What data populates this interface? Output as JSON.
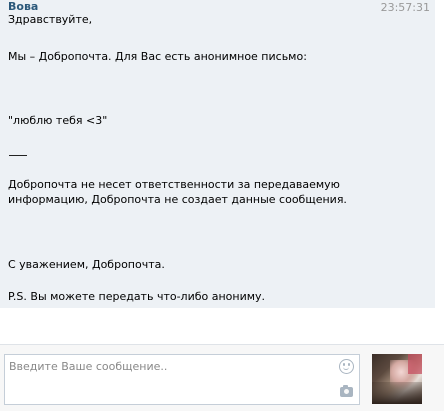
{
  "message": {
    "sender": "Вова",
    "time": "23:57:31",
    "lines": {
      "greeting": "Здравствуйте,",
      "intro": "Мы – Добропочта. Для Вас есть анонимное письмо:",
      "quote": "\"люблю тебя <3\"",
      "disclaimer_1": "Добропочта не несет ответственности за передаваемую",
      "disclaimer_2": "информацию, Добропочта не создает данные сообщения.",
      "signature": "С уважением, Добропочта.",
      "ps": "P.S. Вы можете передать что-либо анониму."
    }
  },
  "composer": {
    "placeholder": "Введите Ваше сообщение..",
    "value": "",
    "emoji_icon": "smile-icon",
    "attach_icon": "camera-icon"
  }
}
